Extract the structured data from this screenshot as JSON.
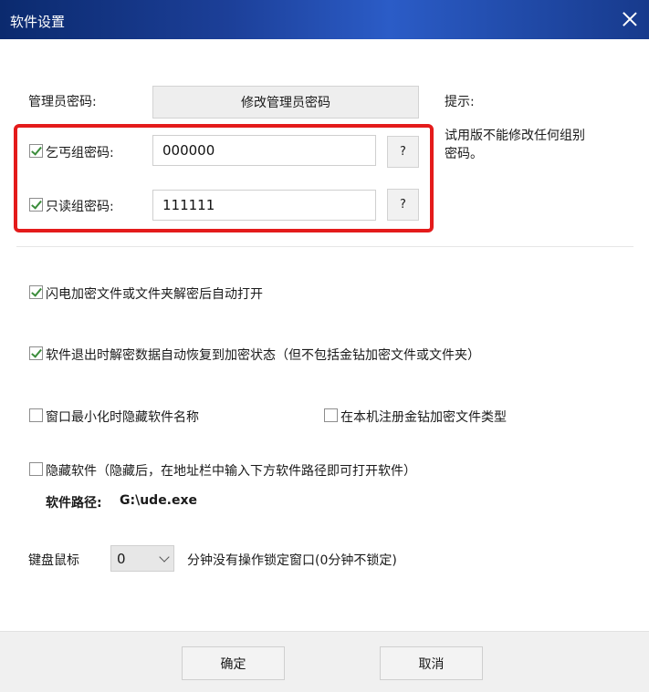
{
  "window": {
    "title": "软件设置"
  },
  "admin": {
    "label": "管理员密码:",
    "button": "修改管理员密码"
  },
  "hint": {
    "title": "提示:",
    "text_line1": "试用版不能修改任何组别",
    "text_line2": "密码。"
  },
  "beggar_group": {
    "label": "乞丐组密码:",
    "checked": true,
    "value": "000000",
    "help": "?"
  },
  "readonly_group": {
    "label": "只读组密码:",
    "checked": true,
    "value": "111111",
    "help": "?"
  },
  "options": {
    "flash_open": {
      "label": "闪电加密文件或文件夹解密后自动打开",
      "checked": true
    },
    "auto_restore": {
      "label": "软件退出时解密数据自动恢复到加密状态（但不包括金钻加密文件或文件夹）",
      "checked": true
    },
    "hide_name": {
      "label": "窗口最小化时隐藏软件名称",
      "checked": false
    },
    "register_type": {
      "label": "在本机注册金钻加密文件类型",
      "checked": false
    },
    "hide_software": {
      "label": "隐藏软件（隐藏后，在地址栏中输入下方软件路径即可打开软件）",
      "checked": false
    }
  },
  "path": {
    "label": "软件路径:",
    "value": "G:\\ude.exe"
  },
  "lock": {
    "prefix": "键盘鼠标",
    "minutes": "0",
    "suffix": "分钟没有操作锁定窗口(0分钟不锁定)"
  },
  "footer": {
    "ok": "确定",
    "cancel": "取消"
  },
  "colors": {
    "titlebar": "#1c3f98",
    "highlight": "#e41b1b",
    "check": "#3a8c3a"
  }
}
